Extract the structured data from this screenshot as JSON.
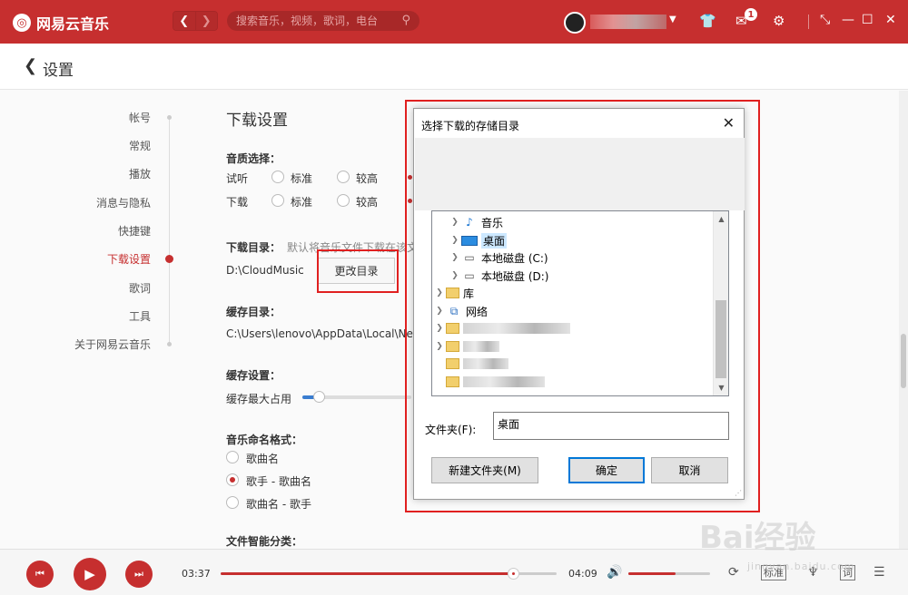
{
  "app": {
    "name": "网易云音乐",
    "logo_glyph": "◎"
  },
  "topbar": {
    "back": "❮",
    "forward": "❯",
    "search_placeholder": "搜索音乐，视频，歌词，电台",
    "mail_badge": "1"
  },
  "page": {
    "title": "设置"
  },
  "sidebar": {
    "items": [
      {
        "label": "帐号"
      },
      {
        "label": "常规"
      },
      {
        "label": "播放"
      },
      {
        "label": "消息与隐私"
      },
      {
        "label": "快捷键"
      },
      {
        "label": "下载设置"
      },
      {
        "label": "歌词"
      },
      {
        "label": "工具"
      },
      {
        "label": "关于网易云音乐"
      }
    ],
    "active": "下载设置"
  },
  "main": {
    "title": "下载设置",
    "quality": {
      "label": "音质选择：",
      "preview_label": "试听",
      "download_label": "下载",
      "opt_standard": "标准",
      "opt_high": "较高"
    },
    "download_dir": {
      "label": "下载目录：",
      "hint": "默认将音乐文件下载在该文",
      "path": "D:\\CloudMusic",
      "change_button": "更改目录"
    },
    "cache_dir": {
      "label": "缓存目录：",
      "path": "C:\\Users\\lenovo\\AppData\\Local\\Netea"
    },
    "cache_settings": {
      "label": "缓存设置：",
      "max_label": "缓存最大占用",
      "level": 0.15
    },
    "naming": {
      "label": "音乐命名格式：",
      "options": [
        "歌曲名",
        "歌手 - 歌曲名",
        "歌曲名 - 歌手"
      ],
      "selected": 1
    },
    "smart_sort": {
      "label": "文件智能分类："
    }
  },
  "dialog": {
    "title": "选择下载的存储目录",
    "tree": [
      {
        "label": "音乐",
        "icon": "music-icon"
      },
      {
        "label": "桌面",
        "icon": "desktop-icon",
        "selected": true
      },
      {
        "label": "本地磁盘 (C:)",
        "icon": "drive-icon"
      },
      {
        "label": "本地磁盘 (D:)",
        "icon": "drive-icon"
      },
      {
        "label": "库",
        "icon": "library-icon"
      },
      {
        "label": "网络",
        "icon": "network-icon"
      }
    ],
    "folder_label": "文件夹(F):",
    "folder_value": "桌面",
    "new_folder_button": "新建文件夹(M)",
    "ok_button": "确定",
    "cancel_button": "取消"
  },
  "player": {
    "current_time": "03:37",
    "total_time": "04:09",
    "progress": 0.87,
    "volume": 0.58,
    "quality_badge": "标准",
    "lyrics_badge": "词"
  },
  "watermark": {
    "text": "Bai经验",
    "sub": "jingyan.baidu.com"
  },
  "colors": {
    "brand": "#c62f2f",
    "highlight": "#e02020",
    "dialog_focus": "#0078d7"
  }
}
